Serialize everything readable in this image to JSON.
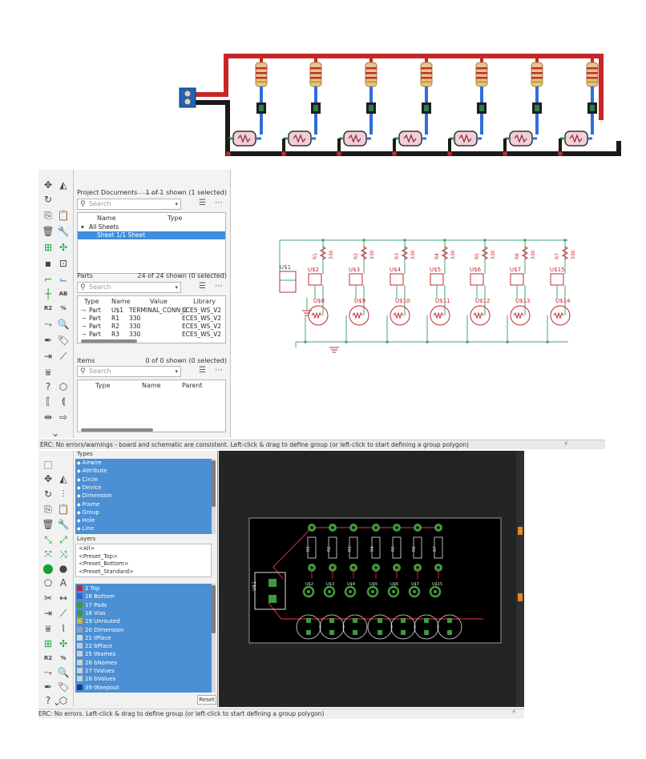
{
  "schematic": {
    "sections": {
      "project_documents": {
        "title": "Project Documents",
        "count": "1 of 1 shown (1 selected)",
        "search_placeholder": "Search",
        "columns": [
          "Name",
          "Type"
        ],
        "tree_root": "All Sheets",
        "selected_item": "Sheet 1/1 Sheet"
      },
      "parts": {
        "title": "Parts",
        "count": "24 of 24 shown (0 selected)",
        "search_placeholder": "Search",
        "columns": [
          "Type",
          "Name",
          "Value",
          "Library"
        ],
        "rows": [
          {
            "type": "Part",
            "name": "U$1",
            "value": "TERMINAL_CONN_2",
            "library": "ECE5_WS_V2"
          },
          {
            "type": "Part",
            "name": "R1",
            "value": "330",
            "library": "ECE5_WS_V2"
          },
          {
            "type": "Part",
            "name": "R2",
            "value": "330",
            "library": "ECE5_WS_V2"
          },
          {
            "type": "Part",
            "name": "R3",
            "value": "330",
            "library": "ECE5_WS_V2"
          }
        ]
      },
      "items": {
        "title": "Items",
        "count": "0 of 0 shown (0 selected)",
        "search_placeholder": "Search",
        "columns": [
          "Type",
          "Name",
          "Parent"
        ]
      }
    },
    "canvas": {
      "terminal_label": "U$1",
      "resistor_labels": [
        "R1",
        "R2",
        "R3",
        "R4",
        "R5",
        "R6",
        "R7"
      ],
      "resistor_value": "330",
      "switch_labels": [
        "U$2",
        "U$3",
        "U$4",
        "U$5",
        "U$6",
        "U$7",
        "U$15"
      ],
      "led_labels": [
        "U$8",
        "U$9",
        "U$10",
        "U$11",
        "U$12",
        "U$13",
        "U$14"
      ]
    },
    "status": "ERC: No errors/warnings - board and schematic are consistent. Left-click & drag to define group (or left-click to start defining a group polygon)"
  },
  "board": {
    "types_title": "Types",
    "types": [
      {
        "label": "Airwire",
        "icon": "airwire-icon"
      },
      {
        "label": "Attribute",
        "icon": "attribute-icon"
      },
      {
        "label": "Circle",
        "icon": "circle-icon"
      },
      {
        "label": "Device",
        "icon": "device-icon"
      },
      {
        "label": "Dimension",
        "icon": "dimension-icon"
      },
      {
        "label": "Frame",
        "icon": "frame-icon"
      },
      {
        "label": "Group",
        "icon": "group-icon"
      },
      {
        "label": "Hole",
        "icon": "hole-icon"
      },
      {
        "label": "Line",
        "icon": "line-icon"
      }
    ],
    "layers_title": "Layers",
    "presets": [
      "<All>",
      "<Preset_Top>",
      "<Preset_Bottom>",
      "<Preset_Standard>"
    ],
    "layers": [
      {
        "label": "1 Top",
        "color": "#c0282f"
      },
      {
        "label": "16 Bottom",
        "color": "#3a5bd9"
      },
      {
        "label": "17 Pads",
        "color": "#3f9a3f"
      },
      {
        "label": "18 Vias",
        "color": "#3f9a3f"
      },
      {
        "label": "19 Unrouted",
        "color": "#c7b53a"
      },
      {
        "label": "20 Dimension",
        "color": "#9e9e9e"
      },
      {
        "label": "21 tPlace",
        "color": "#d8d8d8"
      },
      {
        "label": "22 bPlace",
        "color": "#c8c8c8"
      },
      {
        "label": "25 tNames",
        "color": "#cfcfcf"
      },
      {
        "label": "26 bNames",
        "color": "#cfcfcf"
      },
      {
        "label": "27 tValues",
        "color": "#cfcfcf"
      },
      {
        "label": "28 bValues",
        "color": "#cfcfcf"
      },
      {
        "label": "39 tKeepout",
        "color": "#1a3b8c"
      }
    ],
    "reset_label": "Reset",
    "canvas": {
      "resistor_labels": [
        "R1",
        "R2",
        "R3",
        "R4",
        "R5",
        "R6",
        "R7"
      ],
      "terminal_label": "U$1",
      "switch_labels": [
        "U$2",
        "U$3",
        "U$4",
        "U$5",
        "U$6",
        "U$7",
        "U$15"
      ]
    },
    "status": "ERC: No errors. Left-click & drag to define group (or left-click to start defining a group polygon)"
  }
}
